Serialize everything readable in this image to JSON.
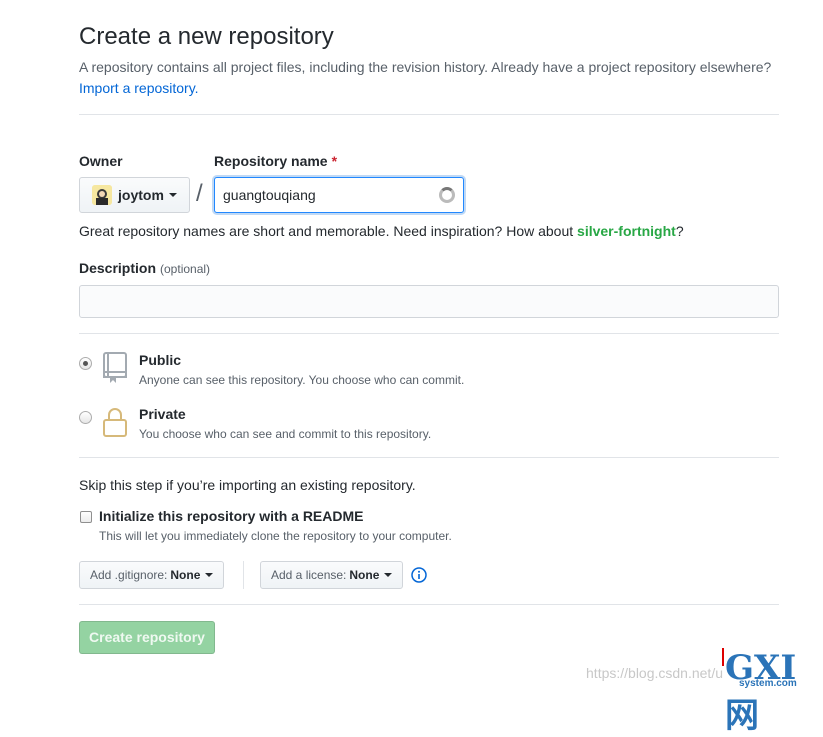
{
  "header": {
    "title": "Create a new repository",
    "subtitle": "A repository contains all project files, including the revision history. Already have a project repository elsewhere?",
    "import_link": "Import a repository."
  },
  "owner": {
    "label": "Owner",
    "value": "joytom"
  },
  "repo_name": {
    "label": "Repository name",
    "required_mark": "*",
    "value": "guangtouqiang"
  },
  "name_hint": {
    "prefix": "Great repository names are short and memorable. Need inspiration? How about ",
    "suggestion": "silver-fortnight",
    "suffix": "?"
  },
  "description": {
    "label": "Description",
    "optional": "(optional)",
    "value": ""
  },
  "visibility": {
    "public": {
      "title": "Public",
      "desc": "Anyone can see this repository. You choose who can commit.",
      "checked": true
    },
    "private": {
      "title": "Private",
      "desc": "You choose who can see and commit to this repository.",
      "checked": false
    }
  },
  "init": {
    "skip_text": "Skip this step if you’re importing an existing repository.",
    "readme_label": "Initialize this repository with a README",
    "readme_desc": "This will let you immediately clone the repository to your computer.",
    "readme_checked": false
  },
  "gitignore": {
    "label": "Add .gitignore:",
    "value": "None"
  },
  "license": {
    "label": "Add a license:",
    "value": "None"
  },
  "submit": {
    "label": "Create repository"
  },
  "watermark": {
    "url": "https://blog.csdn.net/u",
    "logo_big": "GXI网",
    "logo_sub": "system.com"
  },
  "colors": {
    "link": "#0366d6",
    "suggestion": "#28a745",
    "required": "#cb2431",
    "create_disabled": "#94d3a2"
  },
  "icons": {
    "public": "repo-icon",
    "private": "lock-icon",
    "info": "info-icon",
    "owner": "avatar",
    "spinner": "spinner-icon"
  }
}
